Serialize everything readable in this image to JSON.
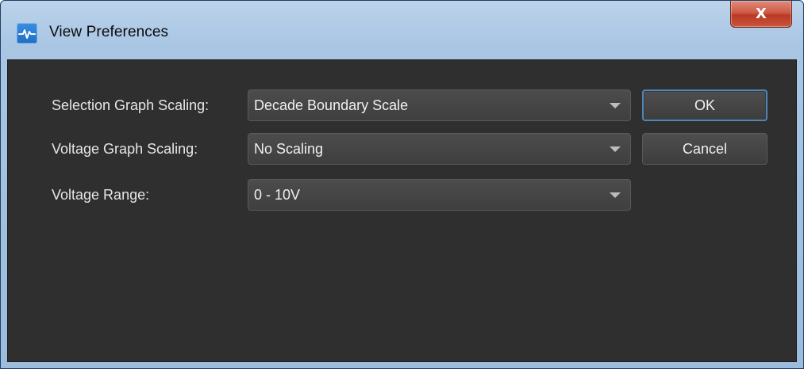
{
  "window": {
    "title": "View Preferences",
    "close_glyph": "X",
    "app_icon": "waveform-icon"
  },
  "form": {
    "rows": [
      {
        "label": "Selection Graph Scaling:",
        "value": "Decade Boundary Scale"
      },
      {
        "label": "Voltage Graph Scaling:",
        "value": "No Scaling"
      },
      {
        "label": "Voltage Range:",
        "value": "0 - 10V"
      }
    ]
  },
  "buttons": {
    "ok": "OK",
    "cancel": "Cancel"
  },
  "colors": {
    "client_background": "#2f2f2f",
    "default_button_border": "#4f86b8",
    "close_button": "#c9543d"
  }
}
